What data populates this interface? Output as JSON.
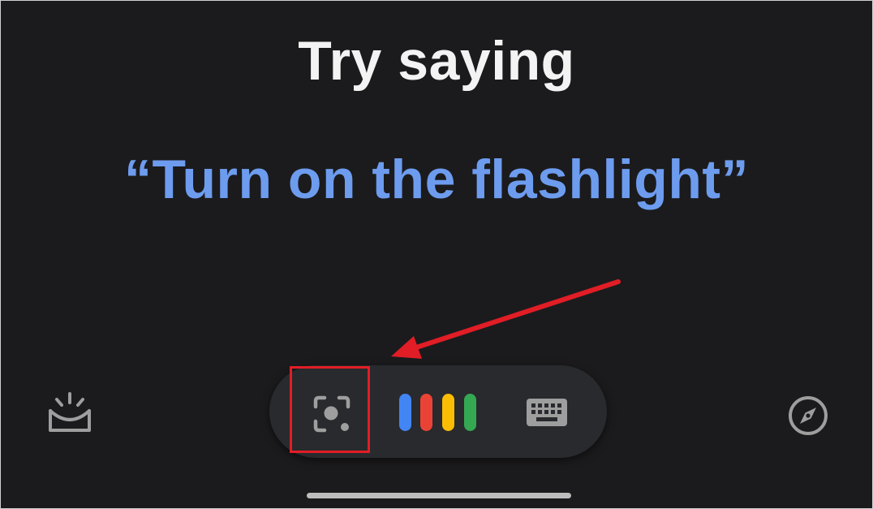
{
  "prompt": {
    "title": "Try saying",
    "suggestion": "“Turn on the flashlight”"
  },
  "toolbar": {
    "left_icon": "snapshot-icon",
    "lens_icon": "lens-icon",
    "mic_icon": "assistant-mic-bars-icon",
    "keyboard_icon": "keyboard-icon",
    "right_icon": "compass-icon",
    "mic_bar_colors": [
      "#4285f4",
      "#ea4335",
      "#fbbc04",
      "#34a853"
    ]
  },
  "annotation": {
    "highlight_color": "#e11d26",
    "arrow_color": "#e11d26"
  },
  "colors": {
    "background": "#1b1b1d",
    "title": "#f3f3f3",
    "suggestion": "#6d9cef",
    "pill": "#282a2d",
    "icon": "#9e9e9e"
  }
}
